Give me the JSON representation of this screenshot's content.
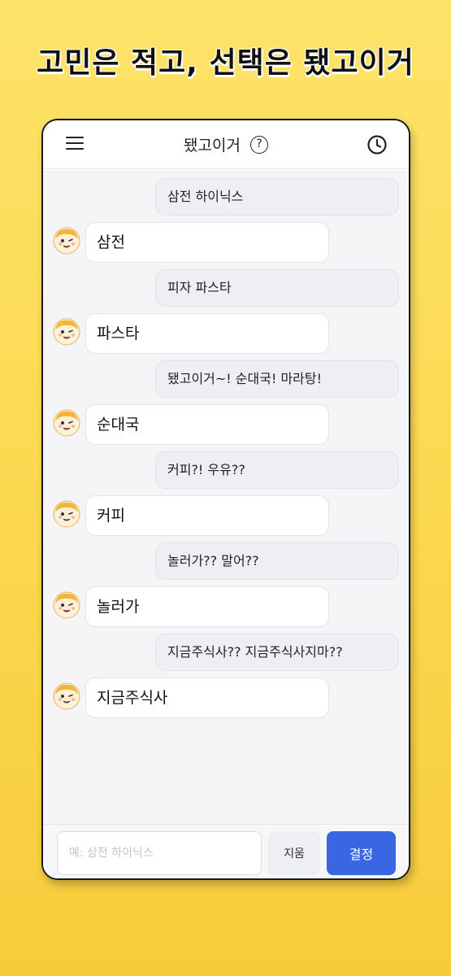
{
  "headline": "고민은 적고, 선택은 됐고이거",
  "header": {
    "title": "됐고이거",
    "help_glyph": "?"
  },
  "messages": [
    {
      "question": "삼전 하이닉스",
      "answer": "삼전"
    },
    {
      "question": "피자 파스타",
      "answer": "파스타"
    },
    {
      "question": "됐고이거~! 순대국! 마라탕!",
      "answer": "순대국"
    },
    {
      "question": "커피?! 우유??",
      "answer": "커피"
    },
    {
      "question": "놀러가?? 말어??",
      "answer": "놀러가"
    },
    {
      "question": "지금주식사?? 지금주식사지마??",
      "answer": "지금주식사"
    }
  ],
  "input": {
    "placeholder": "예: 삼전 하이닉스",
    "value": ""
  },
  "buttons": {
    "clear": "지움",
    "decide": "결정"
  },
  "icons": {
    "menu": "hamburger-icon",
    "help": "question-circle-icon",
    "history": "clock-icon",
    "avatar": "cartoon-face-avatar"
  },
  "colors": {
    "background": "#fbd84e",
    "accent": "#3967e4",
    "chat_bg": "#f5f5f7"
  }
}
